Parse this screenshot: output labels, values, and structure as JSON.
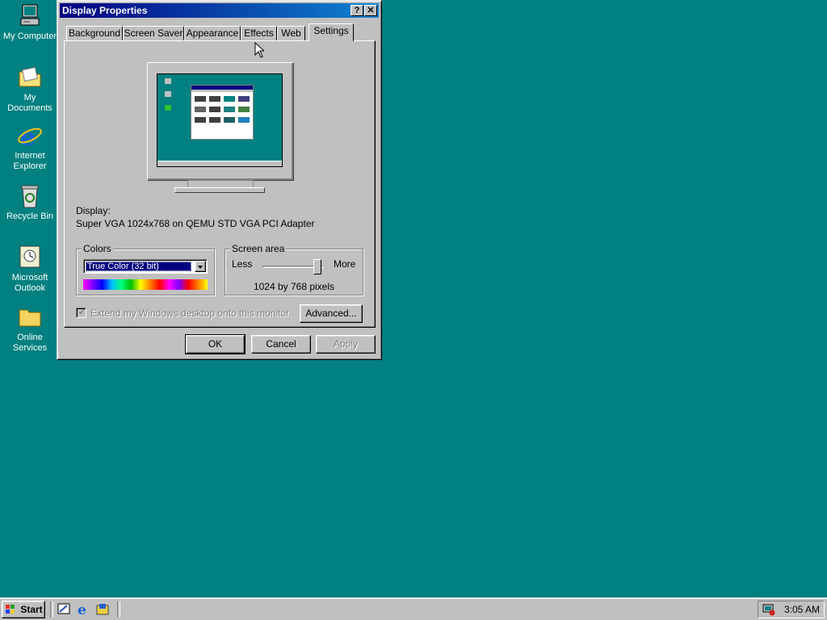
{
  "desktop": {
    "icons": [
      {
        "label_line1": "My Computer",
        "label_line2": ""
      },
      {
        "label_line1": "My Documents",
        "label_line2": ""
      },
      {
        "label_line1": "Internet",
        "label_line2": "Explorer"
      },
      {
        "label_line1": "Recycle Bin",
        "label_line2": ""
      },
      {
        "label_line1": "Microsoft",
        "label_line2": "Outlook"
      },
      {
        "label_line1": "Online",
        "label_line2": "Services"
      }
    ]
  },
  "window": {
    "title": "Display Properties",
    "help_glyph": "?",
    "close_glyph": "✕",
    "tabs": [
      "Background",
      "Screen Saver",
      "Appearance",
      "Effects",
      "Web",
      "Settings"
    ],
    "active_tab": "Settings",
    "display_label": "Display:",
    "display_value": "Super VGA 1024x768 on QEMU STD VGA PCI Adapter",
    "colors": {
      "legend": "Colors",
      "selected": "True Color (32 bit)"
    },
    "screen_area": {
      "legend": "Screen area",
      "less": "Less",
      "more": "More",
      "value": "1024 by 768 pixels",
      "slider_level": 0.95
    },
    "extend_checkbox": "Extend my Windows desktop onto this monitor.",
    "advanced_button": "Advanced...",
    "ok_button": "OK",
    "cancel_button": "Cancel",
    "apply_button": "Apply"
  },
  "taskbar": {
    "start_label": "Start",
    "clock": "3:05 AM"
  },
  "colors": {
    "desktop": "#008080",
    "title_start": "#000080",
    "title_end": "#1084d0"
  }
}
